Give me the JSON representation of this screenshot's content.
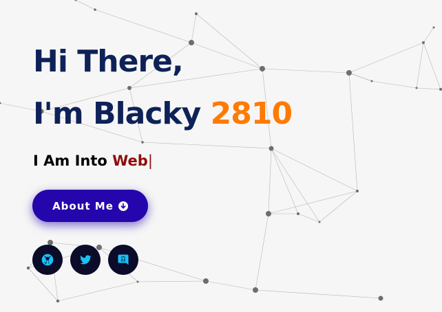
{
  "hero": {
    "greeting": "Hi There,",
    "intro_prefix": "I'm Blacky ",
    "intro_number": "2810",
    "typed_prefix": "I Am Into ",
    "typed_word": "Web",
    "caret": "|"
  },
  "about_button": {
    "label": "About Me",
    "icon": "arrow-down-circle-icon"
  },
  "social_links": [
    {
      "name": "github",
      "icon": "github-icon"
    },
    {
      "name": "twitter",
      "icon": "twitter-icon"
    },
    {
      "name": "discord",
      "icon": "discord-icon"
    }
  ],
  "colors": {
    "background": "#f6f6f6",
    "heading": "#0e2258",
    "name_accent": "#ff7a00",
    "typed_word": "#8e0d0d",
    "button": "#2506ad",
    "social_bg": "#0b0b2a",
    "social_icon": "#18c2f5"
  }
}
